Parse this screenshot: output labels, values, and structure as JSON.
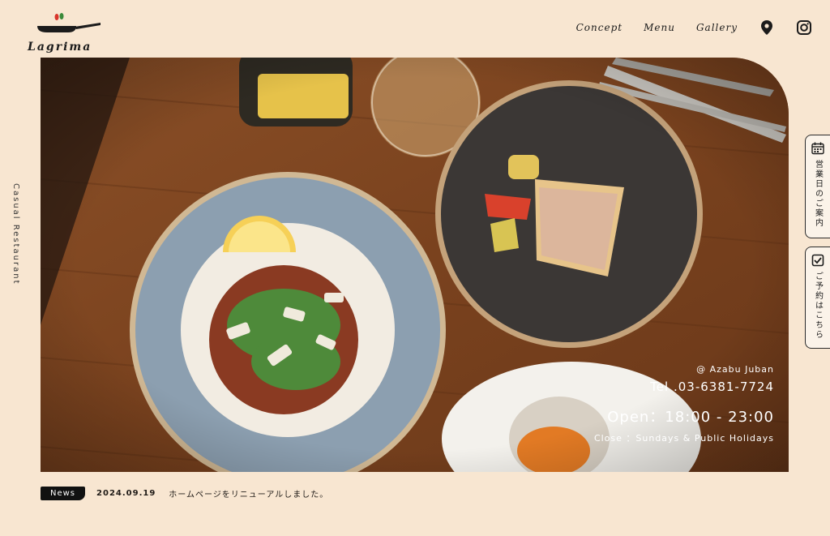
{
  "brand": {
    "name": "Lagrima",
    "tagline": "Casual Restaurant"
  },
  "nav": {
    "items": [
      {
        "label": "Concept"
      },
      {
        "label": "Menu"
      },
      {
        "label": "Gallery"
      }
    ],
    "icons": [
      "map-pin-icon",
      "instagram-icon"
    ]
  },
  "hero": {
    "location": "@ Azabu Juban",
    "tel": "Tel .03-6381-7724",
    "open": "Open：18:00 - 23:00",
    "close": "Close ：Sundays & Public Holidays"
  },
  "side_tabs": {
    "hours": "営業日のご案内",
    "reserve": "ご予約はこちら"
  },
  "news": {
    "badge": "News",
    "date": "2024.09.19",
    "text": "ホームページをリニューアルしました。"
  },
  "colors": {
    "background": "#f8e6d1",
    "table": "#7a4421",
    "text": "#1f1a16"
  }
}
